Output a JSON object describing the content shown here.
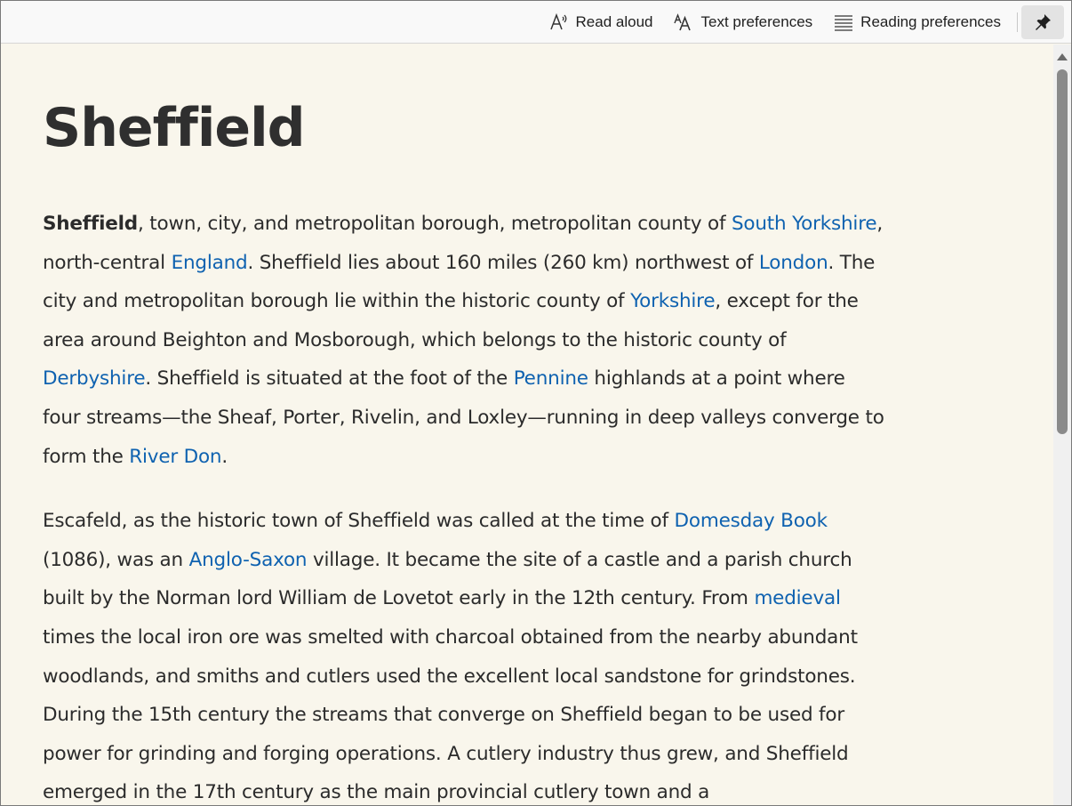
{
  "toolbar": {
    "read_aloud": "Read aloud",
    "text_preferences": "Text preferences",
    "reading_preferences": "Reading preferences"
  },
  "article": {
    "title": "Sheffield",
    "p1": {
      "bold": "Sheffield",
      "t1": ", town, city, and metropolitan borough, metropolitan county of ",
      "l1": "South Yorkshire",
      "t2": ", north-central ",
      "l2": "England",
      "t3": ". Sheffield lies about 160 miles (260 km) northwest of ",
      "l3": "London",
      "t4": ". The city and metropolitan borough lie within the historic county of ",
      "l4": "Yorkshire",
      "t5": ", except for the area around Beighton and Mosborough, which belongs to the historic county of ",
      "l5": "Derbyshire",
      "t6": ". Sheffield is situated at the foot of the ",
      "l6": "Pennine",
      "t7": " highlands at a point where four streams—the Sheaf, Porter, Rivelin, and Loxley—running in deep valleys converge to form the ",
      "l7": "River Don",
      "t8": "."
    },
    "p2": {
      "t1": "Escafeld, as the historic town of Sheffield was called at the time of ",
      "l1": "Domesday Book",
      "t2": " (1086), was an ",
      "l2": "Anglo-Saxon",
      "t3": " village. It became the site of a castle and a parish church built by the Norman lord William de Lovetot early in the 12th century. From ",
      "l3": "medieval",
      "t4": " times the local iron ore was smelted with charcoal obtained from the nearby abundant woodlands, and smiths and cutlers used the excellent local sandstone for grindstones. During the 15th century the streams that converge on Sheffield began to be used for power for grinding and forging operations. A cutlery industry thus grew, and Sheffield emerged in the 17th century as the main provincial cutlery town and a"
    }
  },
  "colors": {
    "link": "#0f62b0",
    "background": "#f9f6ec",
    "text": "#2b2b2b"
  }
}
